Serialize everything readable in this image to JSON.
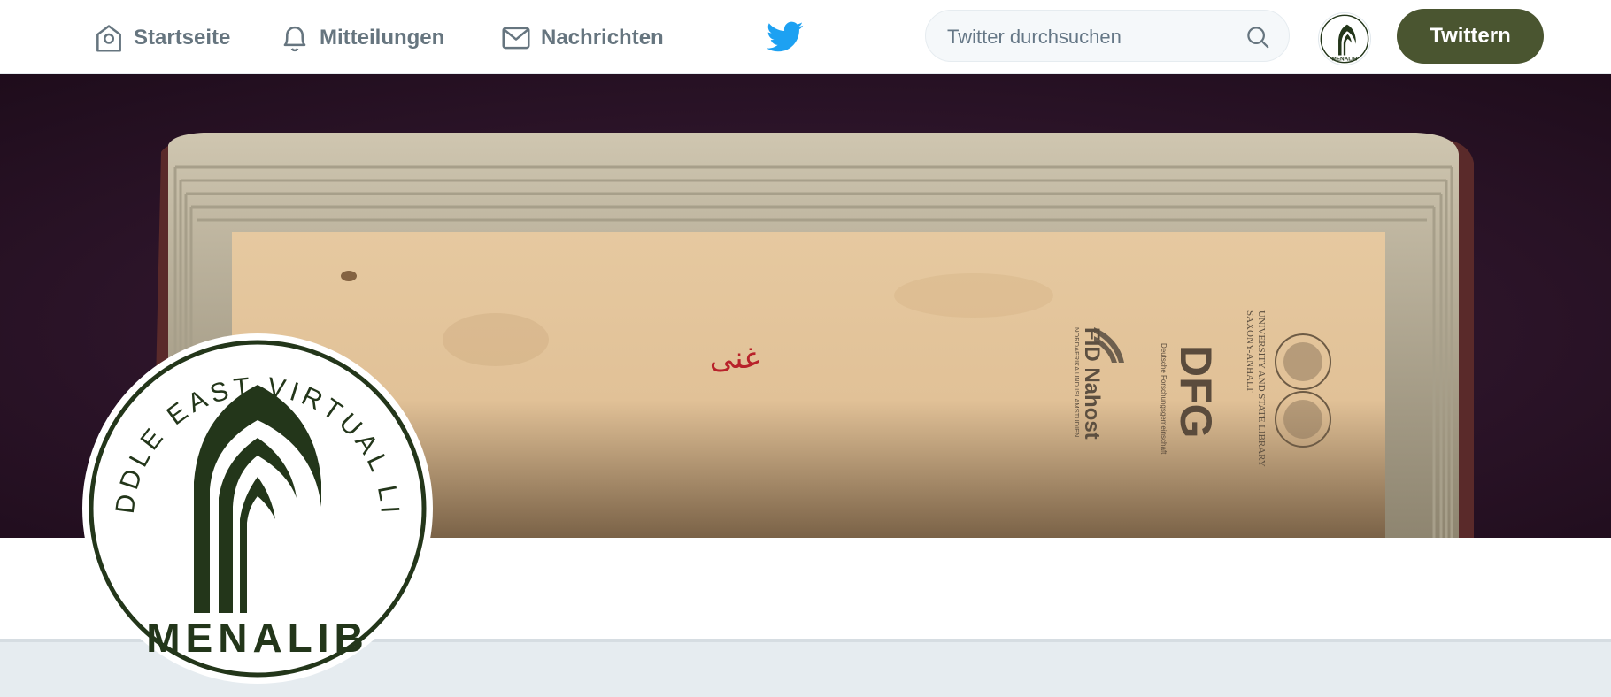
{
  "nav": {
    "items": [
      {
        "label": "Startseite",
        "icon": "home-icon"
      },
      {
        "label": "Mitteilungen",
        "icon": "bell-icon"
      },
      {
        "label": "Nachrichten",
        "icon": "envelope-icon"
      }
    ],
    "logo_icon": "twitter-bird-icon"
  },
  "search": {
    "placeholder": "Twitter durchsuchen",
    "icon": "search-icon"
  },
  "tweet_button": {
    "label": "Twittern"
  },
  "banner": {
    "book_inscription": "غنی",
    "logos": {
      "fid_title": "FID Nahost",
      "fid_subtitle": "NORDAFRIKA UND ISLAMSTUDIEN",
      "dfg_title": "DFG",
      "dfg_subtitle": "Deutsche Forschungsgemeinschaft",
      "ulb_line1": "UNIVERSITY AND STATE LIBRARY",
      "ulb_line2": "SAXONY-ANHALT"
    }
  },
  "profile": {
    "seal_text": "THE MIDDLE EAST VIRTUAL LIBRARY",
    "name": "MENALIB"
  },
  "colors": {
    "accent": "#4a5530",
    "seal_green": "#23361a",
    "banner_bg": "#2a1327",
    "twitter_blue": "#1da1f2"
  }
}
